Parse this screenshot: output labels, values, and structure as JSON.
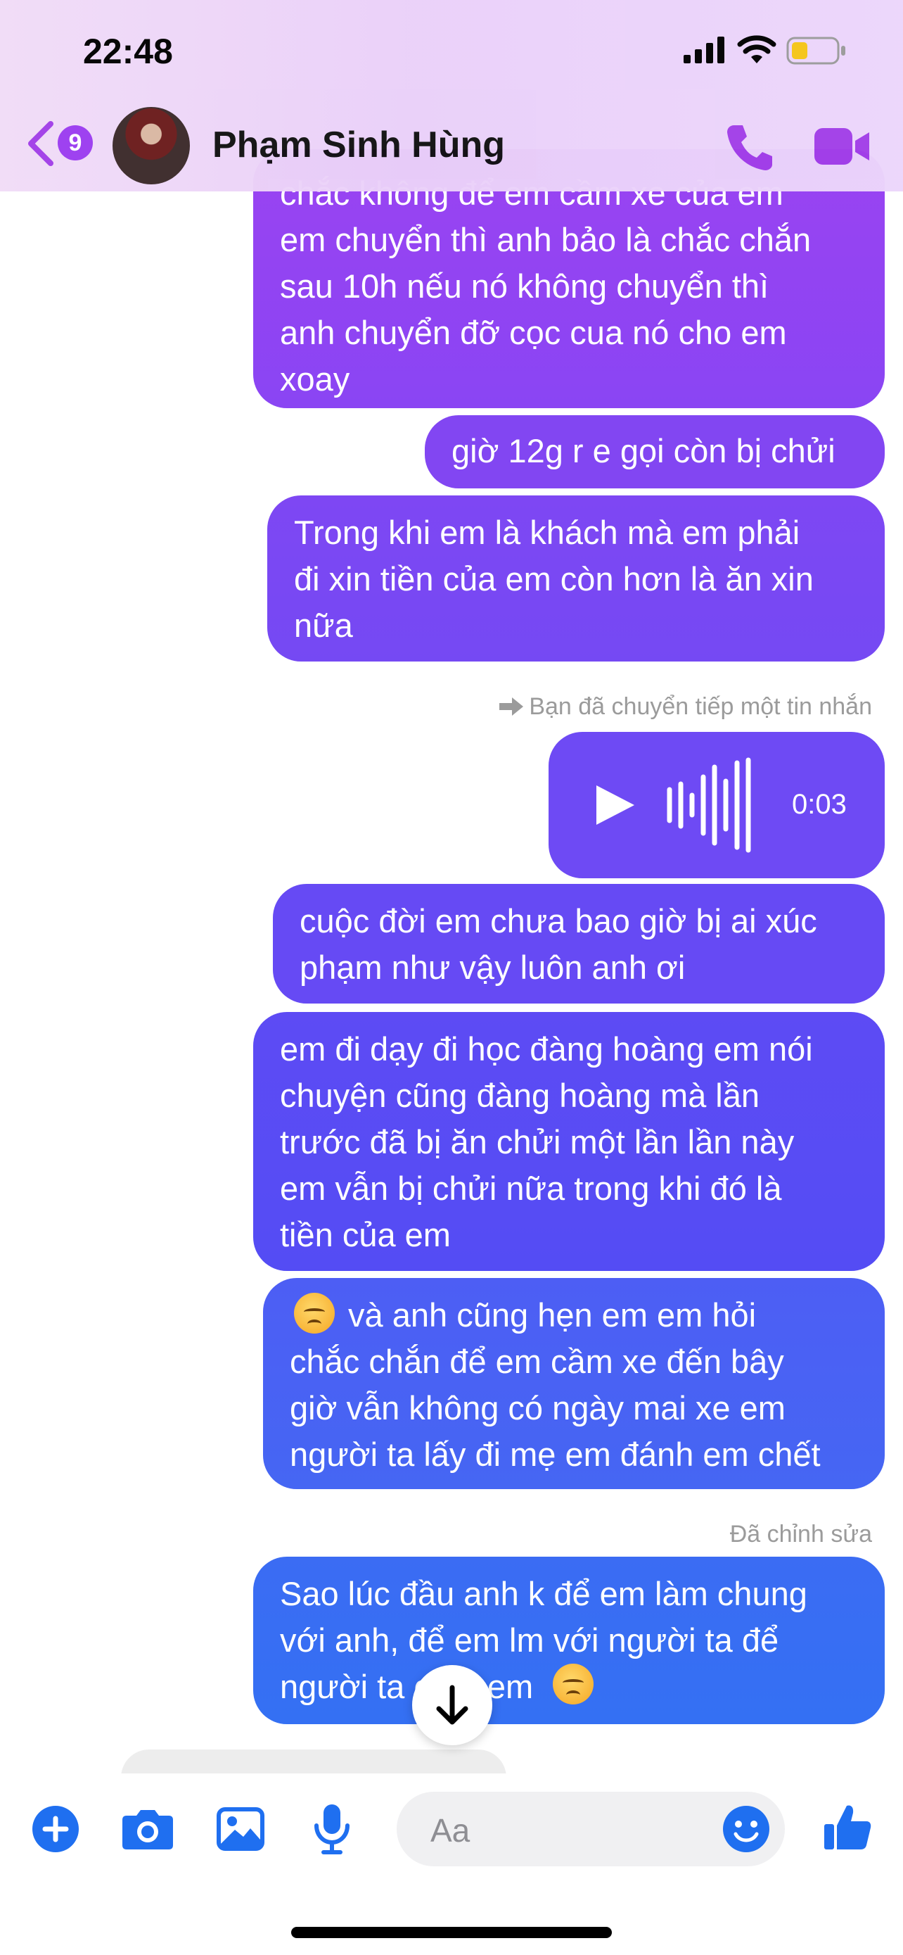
{
  "status_bar": {
    "time": "22:48"
  },
  "header": {
    "back_count": "9",
    "contact_name": "Phạm Sinh Hùng"
  },
  "messages": [
    {
      "text": "chắc không để em cầm xe của em\nem chuyển thì anh bảo là chắc chắn\nsau 10h nếu nó không chuyển thì\nanh chuyển đỡ cọc cua nó cho em\nxoay"
    },
    {
      "text": "giờ 12g r e gọi còn bị chửi"
    },
    {
      "text": "Trong khi em là khách mà em phải\nđi xin tiền của em còn hơn là ăn xin\nnữa"
    },
    {
      "text": "cuộc đời em chưa bao giờ bị ai xúc\nphạm như vậy luôn anh ơi"
    },
    {
      "text": "em đi dạy đi học đàng hoàng em nói\nchuyện cũng đàng hoàng mà lần\ntrước đã bị ăn chửi một lần lần này\nem vẫn bị chửi nữa trong khi đó là\ntiền của em"
    },
    {
      "text_after_emoji": " và anh cũng hẹn em em hỏi\nchắc chắn để em cầm xe đến bây\ngiờ vẫn không có ngày mai xe em\nngười ta lấy đi mẹ em đánh em chết"
    },
    {
      "text": "Sao lúc đầu anh k để em làm chung\nvới anh, để em lm với người ta để\nngười ta chửi em"
    }
  ],
  "forwarded_note": "Bạn đã chuyển tiếp một tin nhắn",
  "voice_message": {
    "duration": "0:03"
  },
  "edited_note": "Đã chỉnh sửa",
  "composer": {
    "placeholder": "Aa"
  },
  "colors": {
    "bubble_purple": "#8a3ff0",
    "bubble_blue": "#3a6bf2",
    "accent_purple": "#a23ee8",
    "accent_blue": "#1f6ff0"
  },
  "icons": [
    "back-chevron-icon",
    "phone-icon",
    "video-camera-icon",
    "play-icon",
    "waveform-icon",
    "arrow-down-icon",
    "plus-icon",
    "camera-icon",
    "image-icon",
    "microphone-icon",
    "smiley-icon",
    "thumbs-up-icon",
    "signal-icon",
    "wifi-icon",
    "battery-icon"
  ]
}
